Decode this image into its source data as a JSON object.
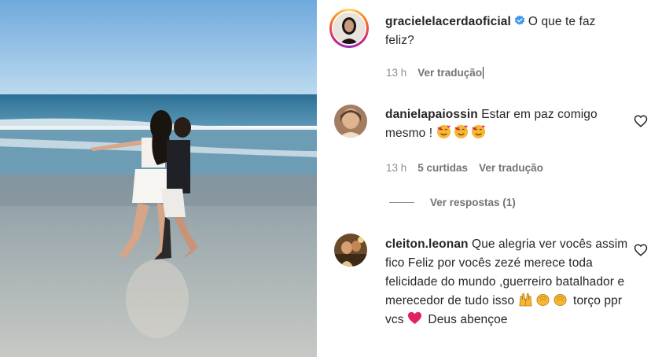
{
  "post": {
    "author": "gracielelacerdaoficial",
    "caption": "O que te faz feliz?",
    "time": "13 h",
    "translate": "Ver tradução"
  },
  "comments": [
    {
      "user": "danielapaiossin",
      "text": "Estar em paz comigo mesmo !",
      "emojis": [
        "smiling-face-with-hearts",
        "smiling-face-with-hearts",
        "smiling-face-with-hearts"
      ],
      "time": "13 h",
      "likes": "5 curtidas",
      "translate": "Ver tradução",
      "view_replies": "Ver respostas (1)"
    },
    {
      "user": "cleiton.leonan",
      "text_a": "Que alegria ver vocês assim fico Feliz por vocês zezé merece toda felicidade do mundo ,guerreiro batalhador e merecedor de tudo isso",
      "text_b": "torço ppr vcs",
      "text_c": "Deus abençoe",
      "emojis": [
        "raising-hands",
        "clapping-hands",
        "clapping-hands",
        "red-heart"
      ]
    }
  ],
  "colors": {
    "verified": "#3897f0",
    "muted": "#8e8e8e",
    "text": "#262626",
    "heart_red": "#e0245e"
  }
}
